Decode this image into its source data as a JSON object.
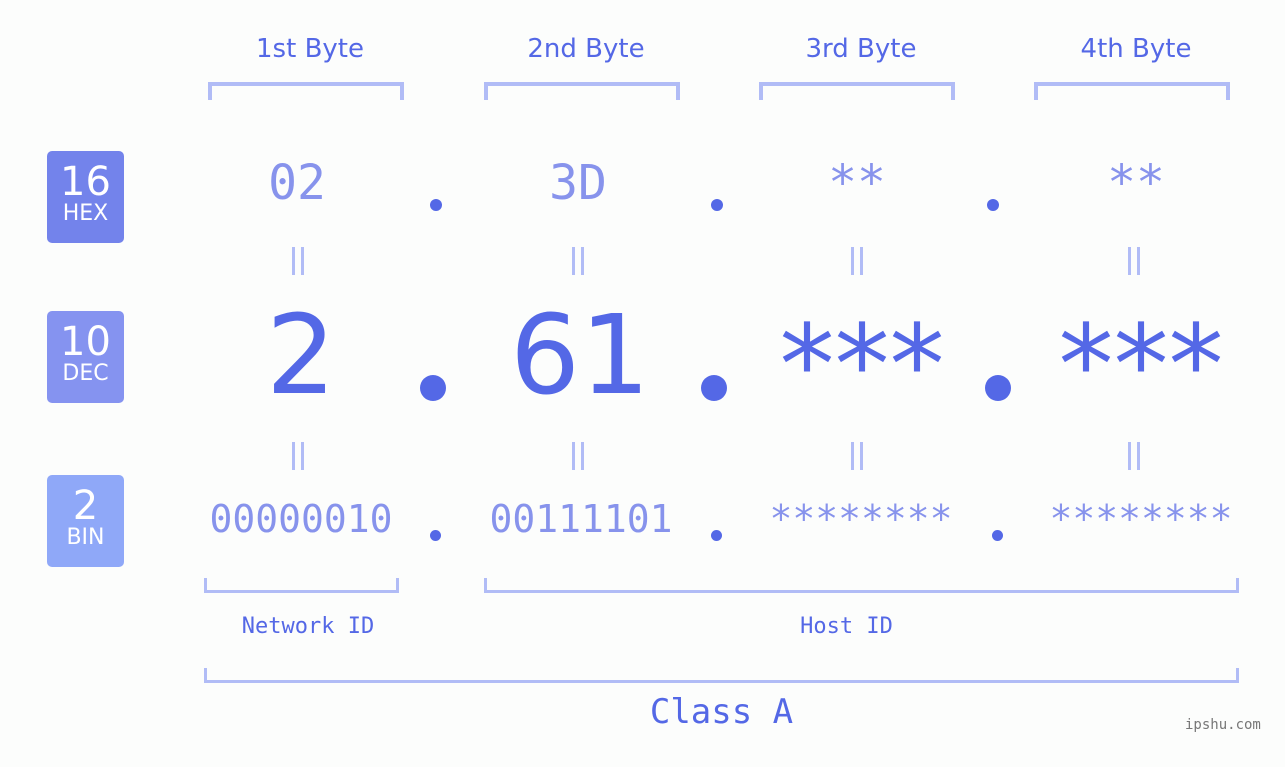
{
  "byte_headers": [
    "1st Byte",
    "2nd Byte",
    "3rd Byte",
    "4th Byte"
  ],
  "badges": [
    {
      "number": "16",
      "label": "HEX",
      "color": "#7383eb"
    },
    {
      "number": "10",
      "label": "DEC",
      "color": "#8593f0"
    },
    {
      "number": "2",
      "label": "BIN",
      "color": "#8fa8f8"
    }
  ],
  "hex": [
    "02",
    "3D",
    "**",
    "**"
  ],
  "dec": [
    "2",
    "61",
    "***",
    "***"
  ],
  "bin": [
    "00000010",
    "00111101",
    "********",
    "********"
  ],
  "separator": ".",
  "network_label": "Network ID",
  "host_label": "Host ID",
  "class_label": "Class A",
  "watermark": "ipshu.com",
  "colors": {
    "primary": "#5468e6",
    "secondary": "#8793ec",
    "bracket": "#b1bcf6",
    "background": "#fcfdfc"
  }
}
